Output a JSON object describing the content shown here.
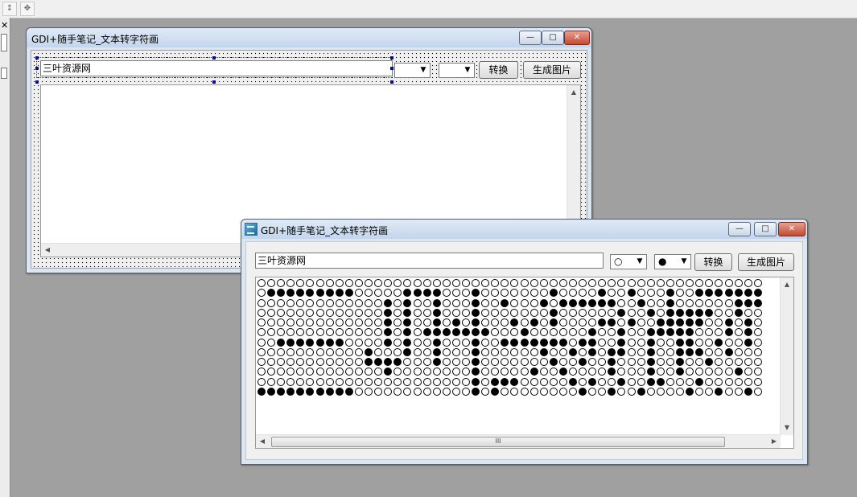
{
  "app_window": {
    "title": "GDI+随手笔记_文本转字符画",
    "input_value": "三叶资源网",
    "empty_symbol": "○",
    "filled_symbol": "●",
    "convert_label": "转换",
    "make_image_label": "生成图片",
    "scroll_thumb_grip": "III"
  },
  "designer_window": {
    "title": "GDI+随手笔记_文本转字符画",
    "input_value": "三叶资源网",
    "convert_label": "转换",
    "make_image_label": "生成图片"
  },
  "caption_glyphs": {
    "minimize": "—",
    "maximize": "□",
    "close": "✕"
  },
  "ascii_art": [
    "....................................................",
    ".#########.....####...#.......#....#..#...#..#######",
    ".............#.#..#...#..#...#.######..#..#......###",
    ".............#.#..#...#.......#......#..#.#####..#..",
    ".............#.#..#.#.#...#.#.#....##.#..#####..#.#.",
    ".............#.#.#######...#......#..#..#####...#.#.",
    "..#######....#.#..#...#..#######.##..#..#..##..#..#.",
    "...........#...#..#...#......#..#.#.##..#..###..#...",
    "...........####...#...#.......#..#..#...#..#..#.....",
    ".............#........#.....#..#....#...#..#.....#..",
    "......................#.###.....#.#..#..##...#......",
    "##########............#.#........#..#..#....#..#..#."
  ]
}
